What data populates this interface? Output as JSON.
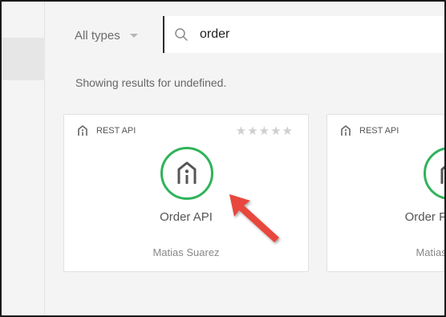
{
  "filter": {
    "type_label": "All types"
  },
  "search": {
    "value": "order"
  },
  "results": {
    "message": "Showing results for undefined."
  },
  "cards": [
    {
      "type": "REST API",
      "rating_stars": "★★★★★",
      "title": "Order API",
      "author": "Matias Suarez"
    },
    {
      "type": "REST API",
      "rating_stars": "",
      "title": "Order Fulfillment",
      "author": "Matias Suarez"
    }
  ],
  "colors": {
    "logo_ring": "#30b35a",
    "arrow": "#e8473e",
    "search_border": "#2c2c2c"
  }
}
